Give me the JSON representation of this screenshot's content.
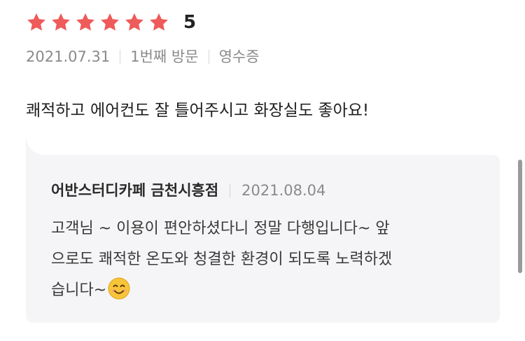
{
  "rating": {
    "stars_filled": 6,
    "stars_total": 6,
    "star_color": "#ef5a5a",
    "score": "5"
  },
  "meta": {
    "date": "2021.07.31",
    "visit": "1번째 방문",
    "verification": "영수증"
  },
  "review": {
    "text": "쾌적하고 에어컨도 잘 틀어주시고 화장실도 좋아요!"
  },
  "reply": {
    "owner_name": "어반스터디카페 금천시흥점",
    "date": "2021.08.04",
    "lines": [
      "고객님 ~ 이용이 편안하셨다니 정말 다행입니다~ 앞",
      "으로도 쾌적한 온도와 청결한 환경이 되도록 노력하겠",
      "습니다~"
    ],
    "emoji": "smiling-face-icon",
    "background": "#f5f5f7"
  }
}
